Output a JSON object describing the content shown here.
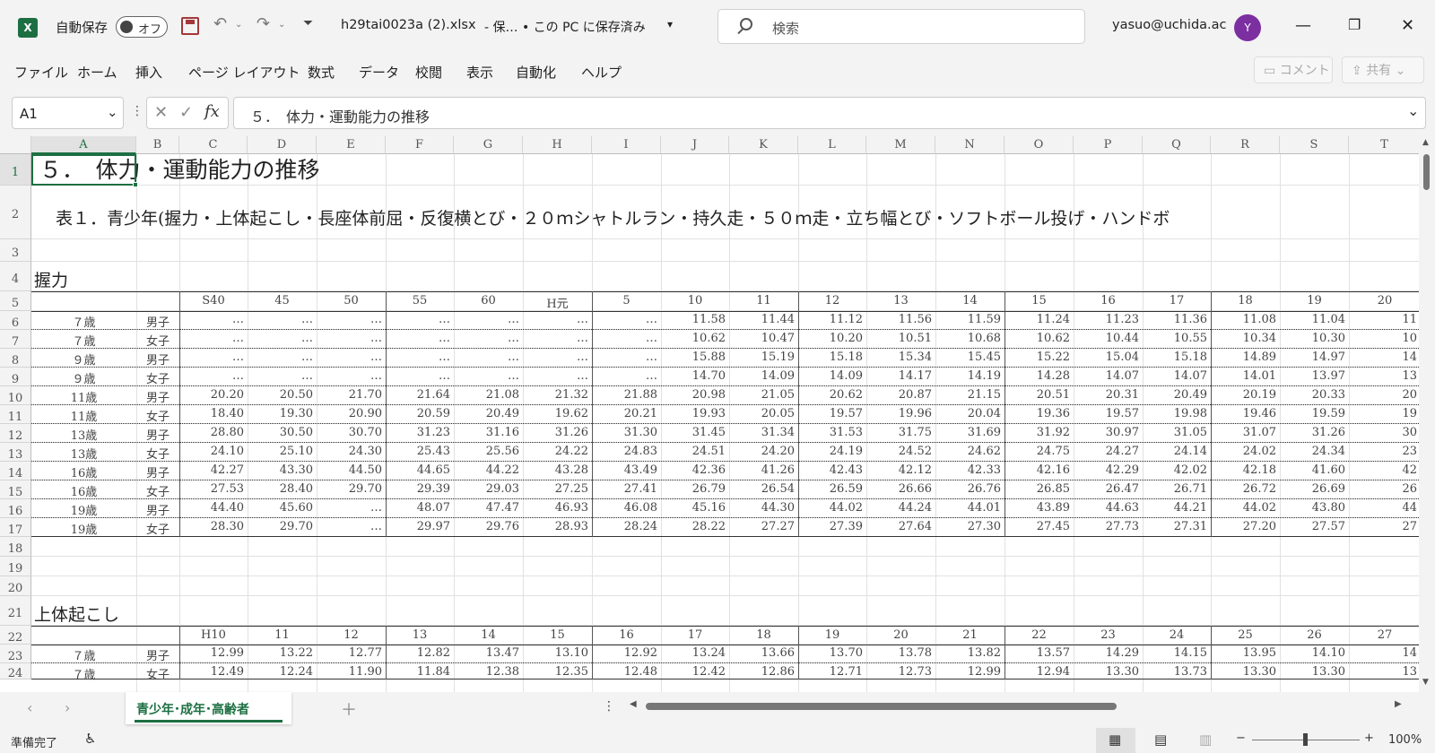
{
  "titlebar": {
    "autosave_label": "自動保存",
    "autosave_state": "オフ",
    "filename": "h29tai0023a (2).xlsx",
    "save_status": "-  保…  • この PC に保存済み",
    "search_placeholder": "検索",
    "account": "yasuo@uchida.ac",
    "avatar_initial": "Y"
  },
  "menu": {
    "items": [
      "ファイル",
      "ホーム",
      "挿入",
      "ページ レイアウト",
      "数式",
      "データ",
      "校閲",
      "表示",
      "自動化",
      "ヘルプ"
    ],
    "comment_label": "コメント",
    "share_label": "共有"
  },
  "formula_bar": {
    "name_box": "A1",
    "content": "５．　体力・運動能力の推移"
  },
  "sheet": {
    "columns": [
      "A",
      "B",
      "C",
      "D",
      "E",
      "F",
      "G",
      "H",
      "I",
      "J",
      "K",
      "L",
      "M",
      "N",
      "O",
      "P",
      "Q",
      "R",
      "S",
      "T"
    ],
    "title": "５．　体力・運動能力の推移",
    "subtitle": "表１．青少年(握力・上体起こし・長座体前屈・反復横とび・２０ｍシャトルラン・持久走・５０ｍ走・立ち幅とび・ソフトボール投げ・ハンドボ",
    "section1": "握力",
    "section2": "上体起こし",
    "years1": [
      "S40",
      "45",
      "50",
      "55",
      "60",
      "H元",
      "5",
      "10",
      "11",
      "12",
      "13",
      "14",
      "15",
      "16",
      "17",
      "18",
      "19",
      "20"
    ],
    "years2": [
      "H10",
      "11",
      "12",
      "13",
      "14",
      "15",
      "16",
      "17",
      "18",
      "19",
      "20",
      "21",
      "22",
      "23",
      "24",
      "25",
      "26",
      "27"
    ],
    "grip_rows": [
      {
        "age": "７歳",
        "sex": "男子",
        "v": [
          "…",
          "…",
          "…",
          "…",
          "…",
          "…",
          "…",
          "11.58",
          "11.44",
          "11.12",
          "11.56",
          "11.59",
          "11.24",
          "11.23",
          "11.36",
          "11.08",
          "11.04",
          "11"
        ]
      },
      {
        "age": "７歳",
        "sex": "女子",
        "v": [
          "…",
          "…",
          "…",
          "…",
          "…",
          "…",
          "…",
          "10.62",
          "10.47",
          "10.20",
          "10.51",
          "10.68",
          "10.62",
          "10.44",
          "10.55",
          "10.34",
          "10.30",
          "10"
        ]
      },
      {
        "age": "９歳",
        "sex": "男子",
        "v": [
          "…",
          "…",
          "…",
          "…",
          "…",
          "…",
          "…",
          "15.88",
          "15.19",
          "15.18",
          "15.34",
          "15.45",
          "15.22",
          "15.04",
          "15.18",
          "14.89",
          "14.97",
          "14"
        ]
      },
      {
        "age": "９歳",
        "sex": "女子",
        "v": [
          "…",
          "…",
          "…",
          "…",
          "…",
          "…",
          "…",
          "14.70",
          "14.09",
          "14.09",
          "14.17",
          "14.19",
          "14.28",
          "14.07",
          "14.07",
          "14.01",
          "13.97",
          "13"
        ]
      },
      {
        "age": "11歳",
        "sex": "男子",
        "v": [
          "20.20",
          "20.50",
          "21.70",
          "21.64",
          "21.08",
          "21.32",
          "21.88",
          "20.98",
          "21.05",
          "20.62",
          "20.87",
          "21.15",
          "20.51",
          "20.31",
          "20.49",
          "20.19",
          "20.33",
          "20"
        ]
      },
      {
        "age": "11歳",
        "sex": "女子",
        "v": [
          "18.40",
          "19.30",
          "20.90",
          "20.59",
          "20.49",
          "19.62",
          "20.21",
          "19.93",
          "20.05",
          "19.57",
          "19.96",
          "20.04",
          "19.36",
          "19.57",
          "19.98",
          "19.46",
          "19.59",
          "19"
        ]
      },
      {
        "age": "13歳",
        "sex": "男子",
        "v": [
          "28.80",
          "30.50",
          "30.70",
          "31.23",
          "31.16",
          "31.26",
          "31.30",
          "31.45",
          "31.34",
          "31.53",
          "31.75",
          "31.69",
          "31.92",
          "30.97",
          "31.05",
          "31.07",
          "31.26",
          "30"
        ]
      },
      {
        "age": "13歳",
        "sex": "女子",
        "v": [
          "24.10",
          "25.10",
          "24.30",
          "25.43",
          "25.56",
          "24.22",
          "24.83",
          "24.51",
          "24.20",
          "24.19",
          "24.52",
          "24.62",
          "24.75",
          "24.27",
          "24.14",
          "24.02",
          "24.34",
          "23"
        ]
      },
      {
        "age": "16歳",
        "sex": "男子",
        "v": [
          "42.27",
          "43.30",
          "44.50",
          "44.65",
          "44.22",
          "43.28",
          "43.49",
          "42.36",
          "41.26",
          "42.43",
          "42.12",
          "42.33",
          "42.16",
          "42.29",
          "42.02",
          "42.18",
          "41.60",
          "42"
        ]
      },
      {
        "age": "16歳",
        "sex": "女子",
        "v": [
          "27.53",
          "28.40",
          "29.70",
          "29.39",
          "29.03",
          "27.25",
          "27.41",
          "26.79",
          "26.54",
          "26.59",
          "26.66",
          "26.76",
          "26.85",
          "26.47",
          "26.71",
          "26.72",
          "26.69",
          "26"
        ]
      },
      {
        "age": "19歳",
        "sex": "男子",
        "v": [
          "44.40",
          "45.60",
          "…",
          "48.07",
          "47.47",
          "46.93",
          "46.08",
          "45.16",
          "44.30",
          "44.02",
          "44.24",
          "44.01",
          "43.89",
          "44.63",
          "44.21",
          "44.02",
          "43.80",
          "44"
        ]
      },
      {
        "age": "19歳",
        "sex": "女子",
        "v": [
          "28.30",
          "29.70",
          "…",
          "29.97",
          "29.76",
          "28.93",
          "28.24",
          "28.22",
          "27.27",
          "27.39",
          "27.64",
          "27.30",
          "27.45",
          "27.73",
          "27.31",
          "27.20",
          "27.57",
          "27"
        ]
      }
    ],
    "situp_rows": [
      {
        "age": "７歳",
        "sex": "男子",
        "v": [
          "12.99",
          "13.22",
          "12.77",
          "12.82",
          "13.47",
          "13.10",
          "12.92",
          "13.24",
          "13.66",
          "13.70",
          "13.78",
          "13.82",
          "13.57",
          "14.29",
          "14.15",
          "13.95",
          "14.10",
          "14"
        ]
      },
      {
        "age": "７歳",
        "sex": "女子",
        "v": [
          "12.49",
          "12.24",
          "11.90",
          "11.84",
          "12.38",
          "12.35",
          "12.48",
          "12.42",
          "12.86",
          "12.71",
          "12.73",
          "12.99",
          "12.94",
          "13.30",
          "13.73",
          "13.30",
          "13.30",
          "13"
        ]
      }
    ]
  },
  "tabs": {
    "active_sheet": "青少年･成年･高齢者"
  },
  "status": {
    "ready": "準備完了",
    "zoom": "100%"
  }
}
